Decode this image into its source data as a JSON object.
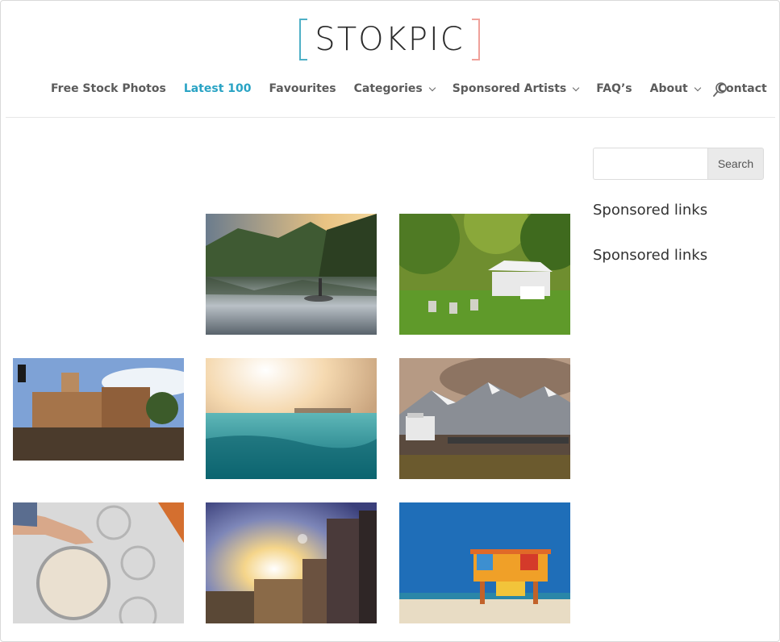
{
  "header": {
    "logo_text": "STOKPIC",
    "logo_colors": {
      "left_bracket": "#4fb0c6",
      "right_bracket": "#f0a19a"
    }
  },
  "nav": {
    "items": [
      {
        "label": "Free Stock Photos",
        "dropdown": false,
        "active": false
      },
      {
        "label": "Latest 100",
        "dropdown": false,
        "active": true
      },
      {
        "label": "Favourites",
        "dropdown": false,
        "active": false
      },
      {
        "label": "Categories",
        "dropdown": true,
        "active": false
      },
      {
        "label": "Sponsored Artists",
        "dropdown": true,
        "active": false
      },
      {
        "label": "FAQ’s",
        "dropdown": false,
        "active": false
      },
      {
        "label": "About",
        "dropdown": true,
        "active": false
      },
      {
        "label": "Contact",
        "dropdown": false,
        "active": false
      }
    ],
    "search_icon": "search-icon",
    "active_color": "#29a3c4"
  },
  "sidebar": {
    "search": {
      "value": "",
      "placeholder": "",
      "button_label": "Search"
    },
    "widgets": [
      {
        "title": "Sponsored links"
      },
      {
        "title": "Sponsored links"
      }
    ]
  },
  "gallery": {
    "photos": [
      {
        "subject": "mountain-lake-reflection-photo"
      },
      {
        "subject": "garden-party-tent-photo"
      },
      {
        "subject": "town-street-buildings-photo"
      },
      {
        "subject": "ocean-sunlight-water-photo"
      },
      {
        "subject": "cruise-ship-mountains-photo"
      },
      {
        "subject": "coffee-drink-table-photo"
      },
      {
        "subject": "city-skyline-sunburst-photo"
      },
      {
        "subject": "lifeguard-tower-beach-photo"
      }
    ]
  }
}
